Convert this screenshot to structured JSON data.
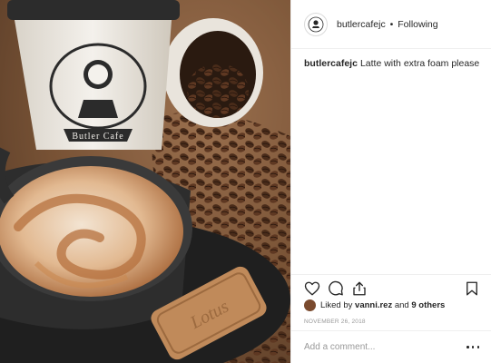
{
  "header": {
    "username": "butlercafejc",
    "separator": "•",
    "follow_status": "Following"
  },
  "caption": {
    "username": "butlercafejc",
    "text": "Latte with extra foam please"
  },
  "photo": {
    "cup_brand": "Butler Cafe",
    "cookie_text": "Lotus"
  },
  "icons": {
    "like": "heart-icon",
    "comment": "comment-icon",
    "share": "share-icon",
    "save": "bookmark-icon",
    "more": "more-options-icon"
  },
  "likes": {
    "prefix": "Liked by",
    "user": "vanni.rez",
    "conjunction": "and",
    "others": "9 others"
  },
  "timestamp": "NOVEMBER 26, 2018",
  "comment_box": {
    "placeholder": "Add a comment..."
  }
}
